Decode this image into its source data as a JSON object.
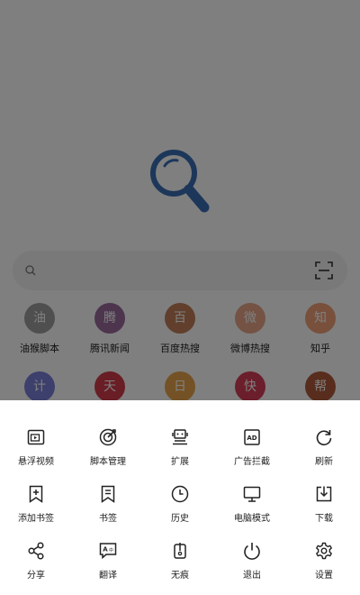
{
  "search": {
    "placeholder": ""
  },
  "shortcuts": [
    {
      "glyph": "油",
      "label": "油猴脚本",
      "color": "#9e9e9e"
    },
    {
      "glyph": "腾",
      "label": "腾讯新闻",
      "color": "#9b6a9c"
    },
    {
      "glyph": "百",
      "label": "百度热搜",
      "color": "#c27e59"
    },
    {
      "glyph": "微",
      "label": "微博热搜",
      "color": "#e8a78a"
    },
    {
      "glyph": "知",
      "label": "知乎",
      "color": "#f0a079"
    },
    {
      "glyph": "计",
      "label": "",
      "color": "#7a7ed8"
    },
    {
      "glyph": "天",
      "label": "",
      "color": "#d23a4a"
    },
    {
      "glyph": "日",
      "label": "",
      "color": "#e8a44a"
    },
    {
      "glyph": "快",
      "label": "",
      "color": "#d63c57"
    },
    {
      "glyph": "帮",
      "label": "",
      "color": "#b05a3a"
    }
  ],
  "menu": [
    {
      "label": "悬浮视频",
      "icon": "floating-video-icon"
    },
    {
      "label": "脚本管理",
      "icon": "script-manage-icon"
    },
    {
      "label": "扩展",
      "icon": "extension-icon"
    },
    {
      "label": "广告拦截",
      "icon": "ad-block-icon"
    },
    {
      "label": "刷新",
      "icon": "refresh-icon"
    },
    {
      "label": "添加书签",
      "icon": "add-bookmark-icon"
    },
    {
      "label": "书签",
      "icon": "bookmark-icon"
    },
    {
      "label": "历史",
      "icon": "history-icon"
    },
    {
      "label": "电脑模式",
      "icon": "desktop-mode-icon"
    },
    {
      "label": "下载",
      "icon": "download-icon"
    },
    {
      "label": "分享",
      "icon": "share-icon"
    },
    {
      "label": "翻译",
      "icon": "translate-icon"
    },
    {
      "label": "无痕",
      "icon": "incognito-icon"
    },
    {
      "label": "退出",
      "icon": "power-icon"
    },
    {
      "label": "设置",
      "icon": "settings-icon"
    }
  ],
  "colors": {
    "logo": "#3a6fb5",
    "dim_overlay": "rgba(0,0,0,0.5)",
    "sheet_bg": "#ffffff"
  }
}
